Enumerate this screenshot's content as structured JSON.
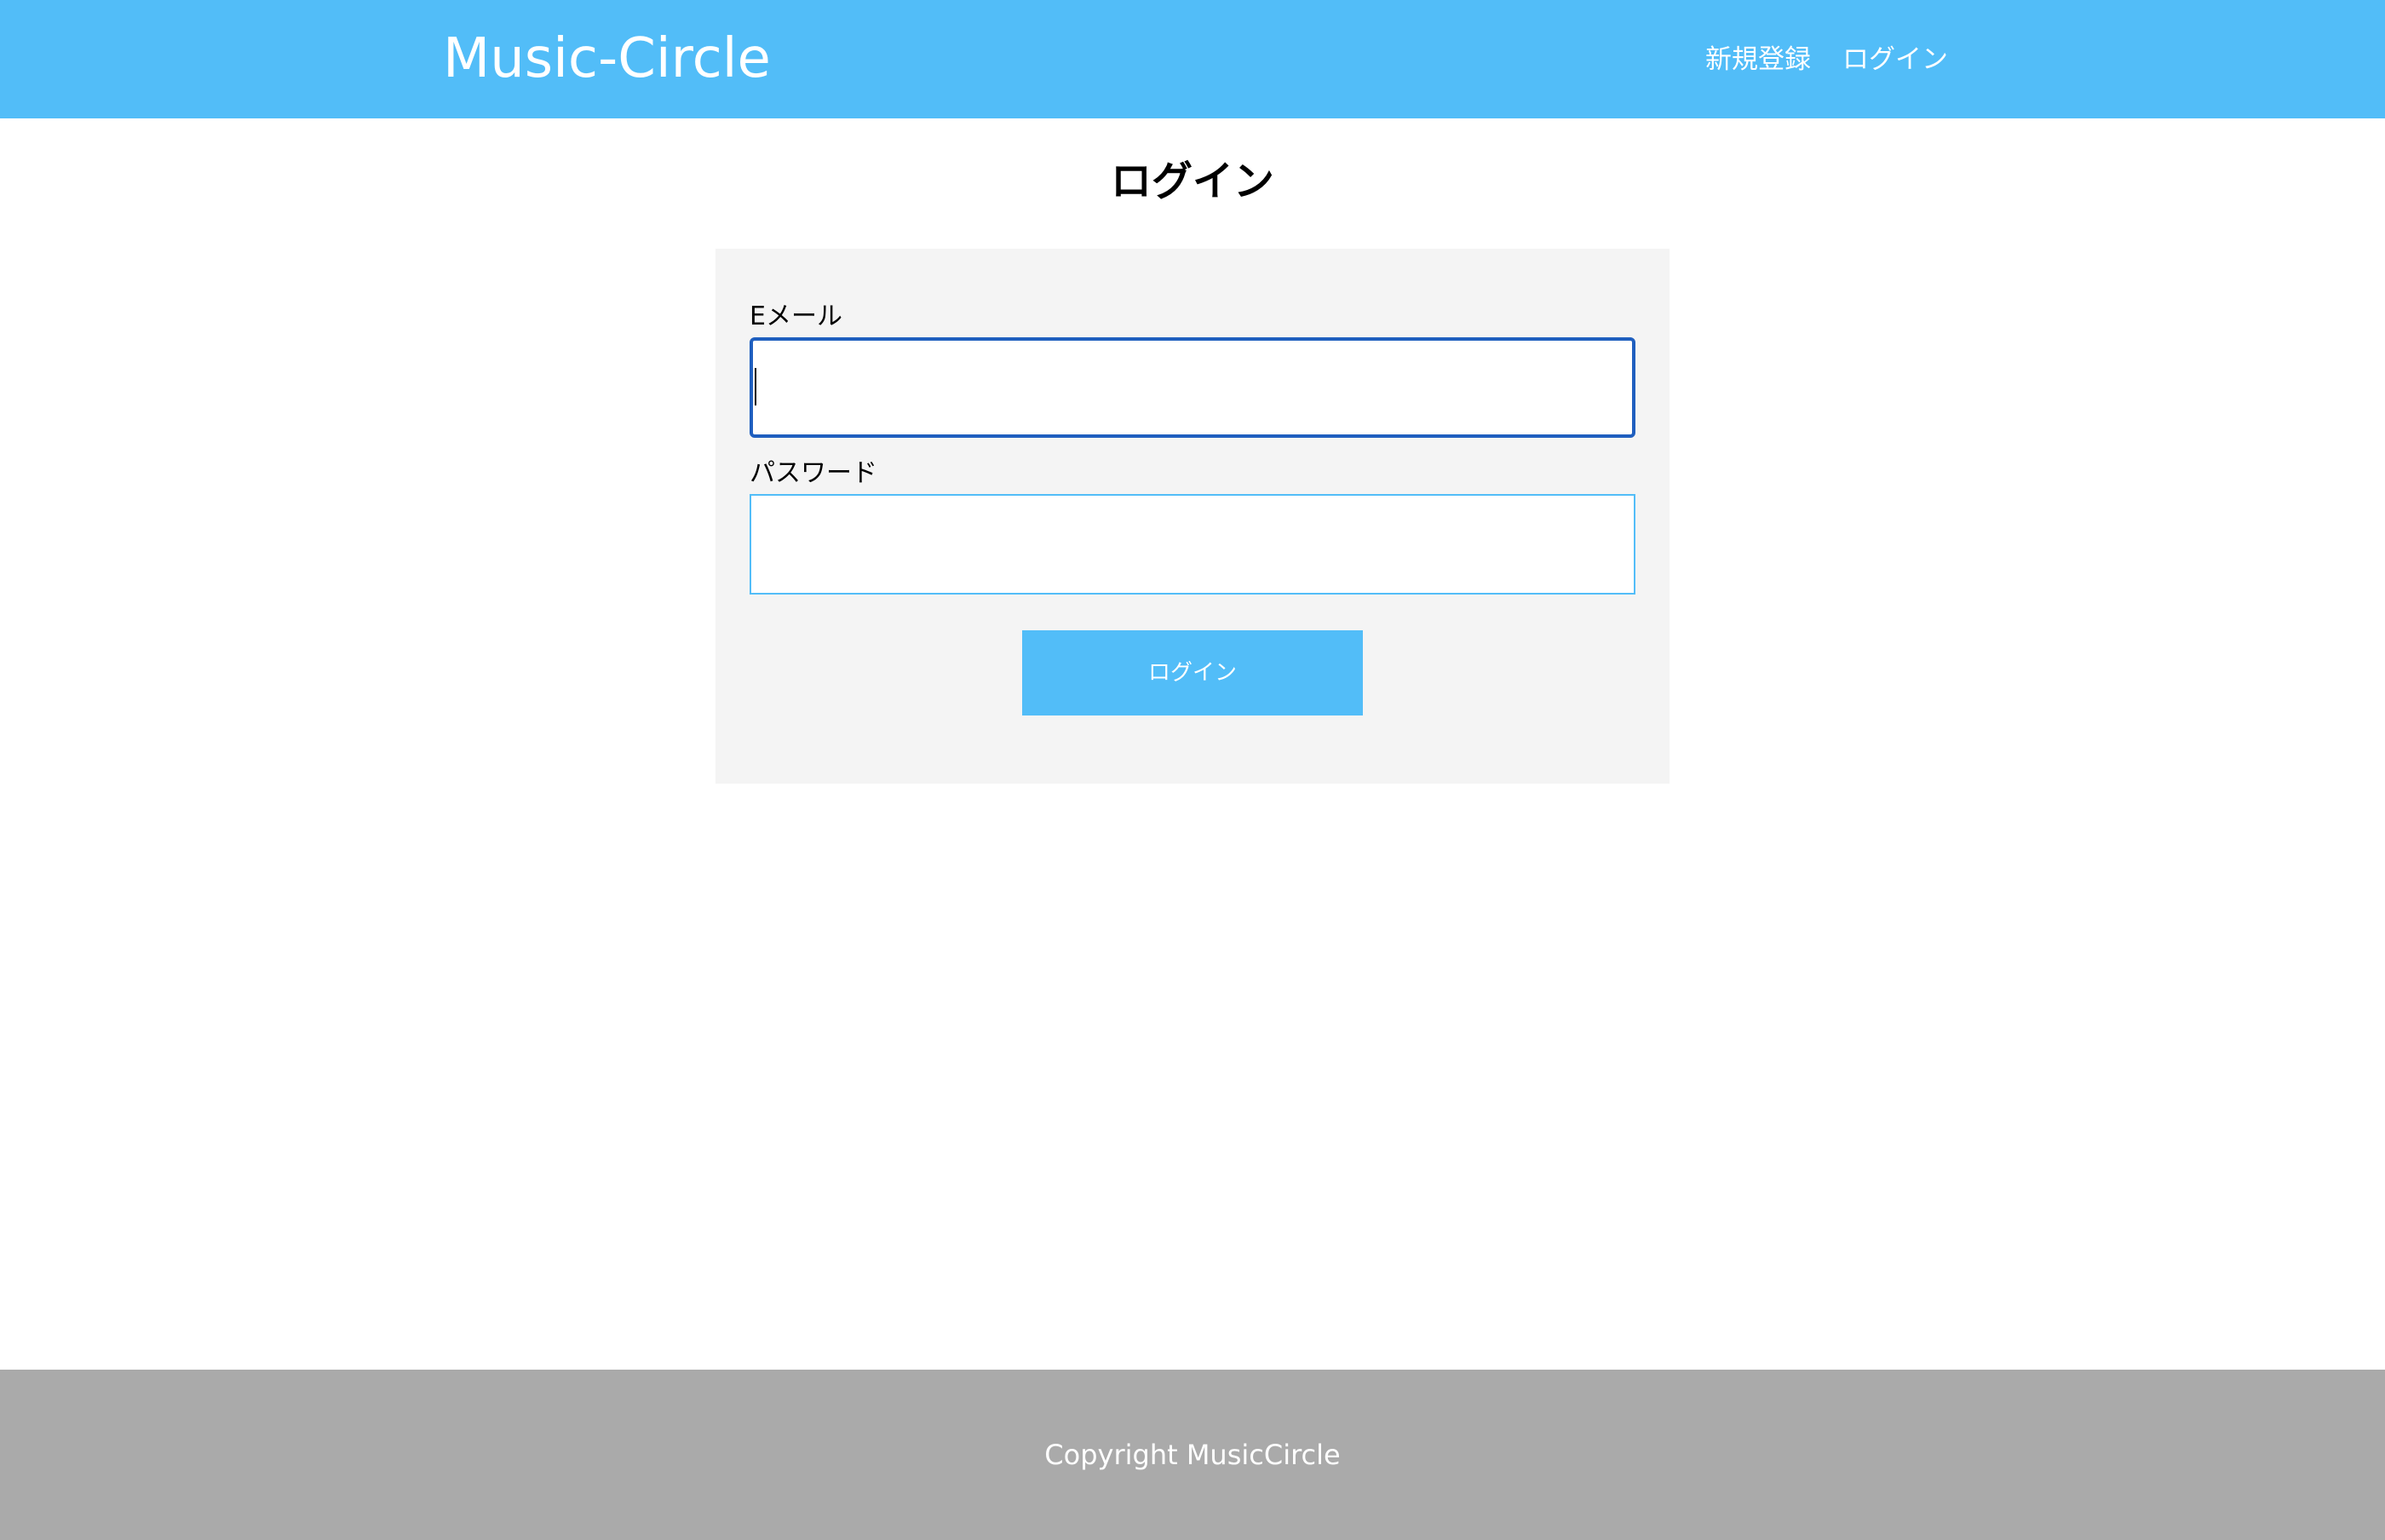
{
  "header": {
    "logo": "Music-Circle",
    "nav": {
      "signup": "新規登録",
      "login": "ログイン"
    },
    "background_color": "#52bdf8"
  },
  "main": {
    "title": "ログイン",
    "form": {
      "email": {
        "label": "Eメール",
        "value": "",
        "focused": true
      },
      "password": {
        "label": "パスワード",
        "value": ""
      },
      "submit_label": "ログイン"
    }
  },
  "footer": {
    "text": "Copyright MusicCircle",
    "background_color": "#aaaaaa"
  }
}
